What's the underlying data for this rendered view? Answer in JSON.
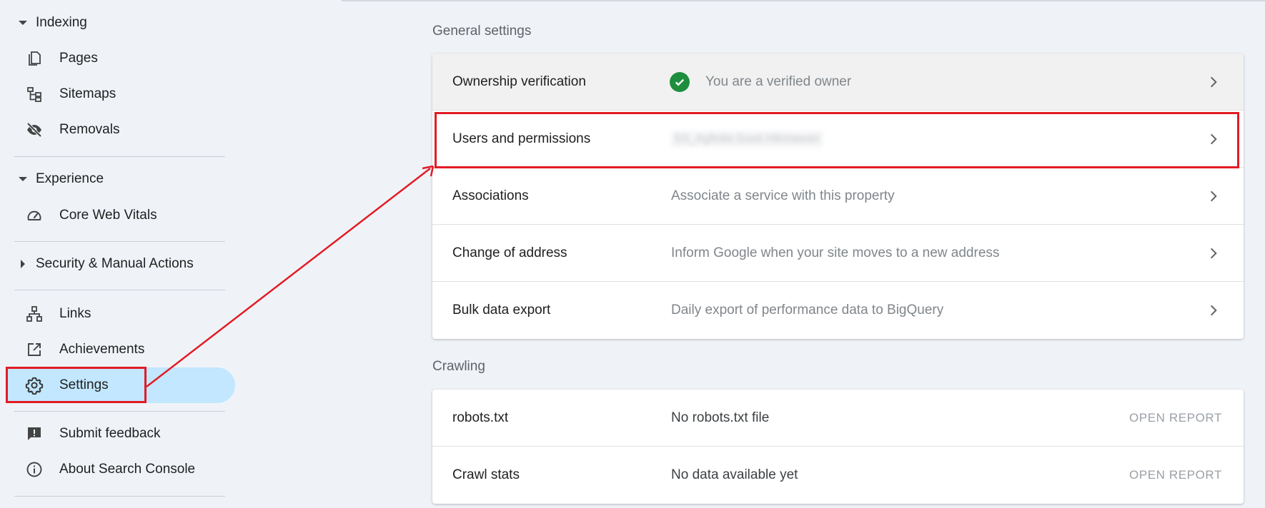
{
  "sidebar": {
    "sections": [
      {
        "label": "Indexing",
        "expanded": true
      },
      {
        "label": "Experience",
        "expanded": true
      },
      {
        "label": "Security & Manual Actions",
        "expanded": false
      }
    ],
    "items": [
      {
        "label": "Pages",
        "icon": "pages-icon"
      },
      {
        "label": "Sitemaps",
        "icon": "sitemap-icon"
      },
      {
        "label": "Removals",
        "icon": "eye-off-icon"
      },
      {
        "label": "Core Web Vitals",
        "icon": "speedometer-icon"
      },
      {
        "label": "Links",
        "icon": "links-icon"
      },
      {
        "label": "Achievements",
        "icon": "external-link-icon"
      },
      {
        "label": "Settings",
        "icon": "gear-icon",
        "active": true
      },
      {
        "label": "Submit feedback",
        "icon": "feedback-icon"
      },
      {
        "label": "About Search Console",
        "icon": "info-icon"
      }
    ]
  },
  "general_settings": {
    "title": "General settings",
    "rows": [
      {
        "label": "Ownership verification",
        "value": "You are a verified owner",
        "status_icon": "check-circle-icon"
      },
      {
        "label": "Users and permissions",
        "value": "SS_Agfinila Gusti Hikmawan",
        "blurred": true,
        "highlighted": true
      },
      {
        "label": "Associations",
        "value": "Associate a service with this property"
      },
      {
        "label": "Change of address",
        "value": "Inform Google when your site moves to a new address"
      },
      {
        "label": "Bulk data export",
        "value": "Daily export of performance data to BigQuery"
      }
    ]
  },
  "crawling": {
    "title": "Crawling",
    "rows": [
      {
        "label": "robots.txt",
        "value": "No robots.txt file",
        "action": "OPEN REPORT"
      },
      {
        "label": "Crawl stats",
        "value": "No data available yet",
        "action": "OPEN REPORT"
      }
    ]
  },
  "colors": {
    "highlight_red": "#e31b23",
    "active_nav": "#c2e7ff",
    "verified_green": "#1e8e3e"
  }
}
